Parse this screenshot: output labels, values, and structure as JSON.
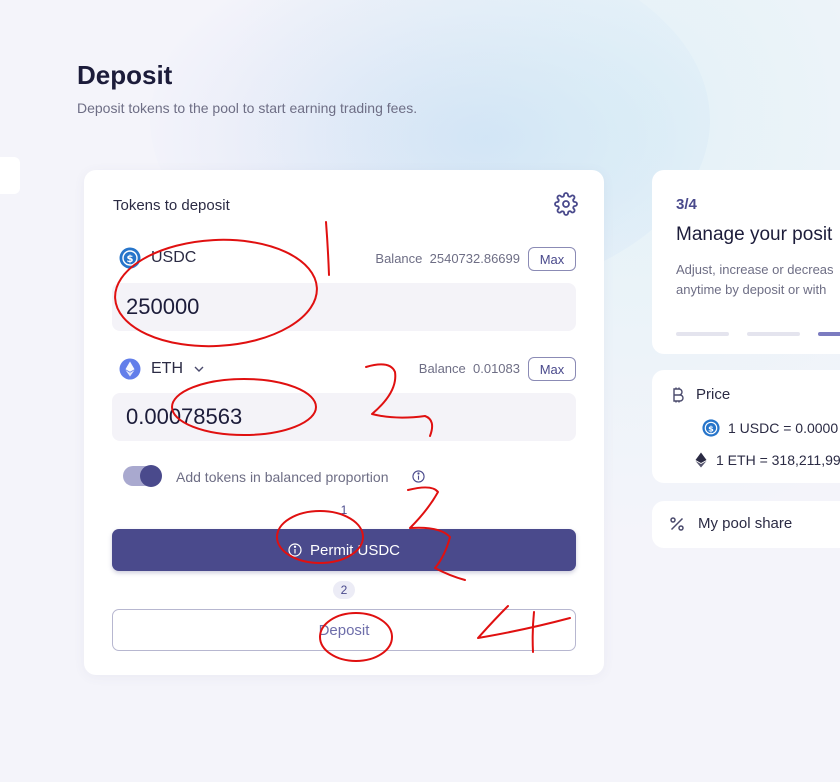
{
  "page": {
    "title": "Deposit",
    "subtitle": "Deposit tokens to the pool to start earning trading fees."
  },
  "deposit_card": {
    "title": "Tokens to deposit",
    "token_a": {
      "symbol": "USDC",
      "balance_label": "Balance",
      "balance_value": "2540732.86699",
      "max_label": "Max",
      "amount": "250000"
    },
    "token_b": {
      "symbol": "ETH",
      "balance_label": "Balance",
      "balance_value": "0.01083",
      "max_label": "Max",
      "amount": "0.00078563"
    },
    "balanced_toggle": {
      "label": "Add tokens in balanced proportion",
      "on": true
    },
    "step1_number": "1",
    "permit_button_label": "Permit USDC",
    "step2_number": "2",
    "deposit_button_label": "Deposit"
  },
  "step_card": {
    "step": "3/4",
    "title": "Manage your posit",
    "desc_line1": "Adjust, increase or decreas",
    "desc_line2": "anytime by deposit or with"
  },
  "price_card": {
    "title": "Price",
    "line1": "1 USDC = 0.0000",
    "line2": "1 ETH = 318,211,99"
  },
  "share_card": {
    "title": "My pool share"
  },
  "colors": {
    "accent": "#4a4a8c",
    "usdc": "#2775ca",
    "eth": "#627eea",
    "annotation": "#e01010"
  },
  "annotations": [
    "1",
    "2",
    "3",
    "4"
  ]
}
